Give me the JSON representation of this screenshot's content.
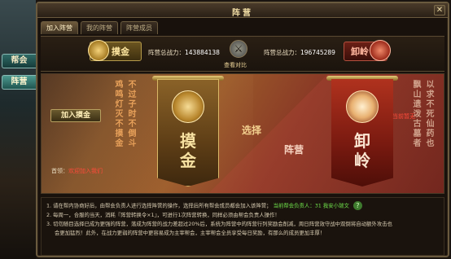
{
  "side_tabs": [
    "帮会",
    "阵营"
  ],
  "window": {
    "title": "阵营",
    "close": "✕"
  },
  "tabs": [
    "加入阵营",
    "我的阵营",
    "阵营成员"
  ],
  "header": {
    "faction_left": {
      "name": "摸金",
      "power_label": "阵营总战力：",
      "power_value": "143884138"
    },
    "faction_right": {
      "name": "卸岭",
      "power_label": "阵营总战力：",
      "power_value": "196745289"
    },
    "compare_label": "查看对比"
  },
  "main": {
    "couplet_left": [
      "鸡鸣灯灭不摸金",
      "不过子时不倒斗"
    ],
    "couplet_right": [
      "以求不死仙药也",
      "飘山遗泼古墓者"
    ],
    "banner_left_name": "摸金",
    "banner_right_name": "卸岭",
    "mid_words": [
      "选择",
      "阵营"
    ],
    "leader_left_label": "首领：",
    "leader_left_name": "欢迎加入我们",
    "leader_right_name": "当前暂无"
  },
  "actions": {
    "join_label": "加入摸金"
  },
  "notes": {
    "line1": "1. 请在帮内协商好后，由帮会负责人进行选择阵营的操作，选择后所有帮会成员都会加入该阵营；",
    "status": "当前帮会负责人：31 我安小瑞文",
    "line2": "2. 每周一，合服的当天，消耗『阵营转换令×1』，可进行1次阵营转换，同样必须由帮会负责人操作！",
    "line3": "3. 切勿随目选择已成为更强的阵营，落成为阵营的战力差超过20%后，系统为阵营中的阵营行列奖励会削减，周日阵营效守战中双倒将自动额外攻击也",
    "line3b": "会更加猛烈！此外，在战力更弱的阵营中更容易成为主宰帮会，主宰帮会全员享受每日奖励，有那么的成员更加丰厚！"
  },
  "icons": {
    "help": "help-icon",
    "vs": "crossed-swords-icon"
  }
}
